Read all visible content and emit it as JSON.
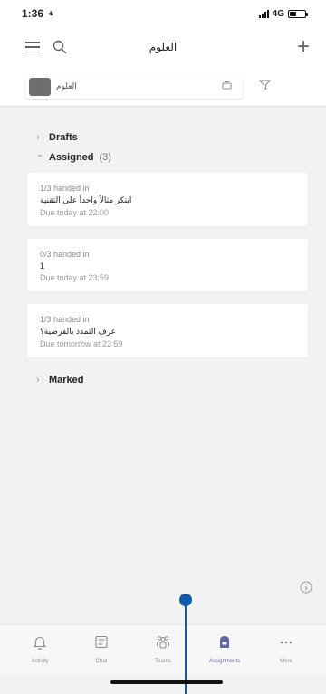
{
  "status_bar": {
    "time": "1:36",
    "network": "4G"
  },
  "header": {
    "title": "العلوم"
  },
  "class_selector": {
    "name": "العلوم"
  },
  "sections": {
    "drafts": {
      "label": "Drafts"
    },
    "assigned": {
      "label": "Assigned",
      "count": "(3)"
    },
    "marked": {
      "label": "Marked"
    }
  },
  "assignments": [
    {
      "status": "1/3 handed in",
      "title": "ابتكر مثالاً واحداً على التقنية",
      "due": "Due today at 22:00"
    },
    {
      "status": "0/3 handed in",
      "title": "1",
      "due": "Due today at 23:59"
    },
    {
      "status": "1/3 handed in",
      "title": "عرف التمدد بالفرضية؟",
      "due": "Due tomorrow at 23:59"
    }
  ],
  "tabs": [
    {
      "label": "Activity",
      "icon": "bell-icon"
    },
    {
      "label": "Chat",
      "icon": "chat-icon"
    },
    {
      "label": "Teams",
      "icon": "teams-icon"
    },
    {
      "label": "Assignments",
      "icon": "assignments-icon"
    },
    {
      "label": "More",
      "icon": "more-icon"
    }
  ],
  "colors": {
    "accent": "#6264a7",
    "scroll_marker": "#0f5ba8"
  }
}
